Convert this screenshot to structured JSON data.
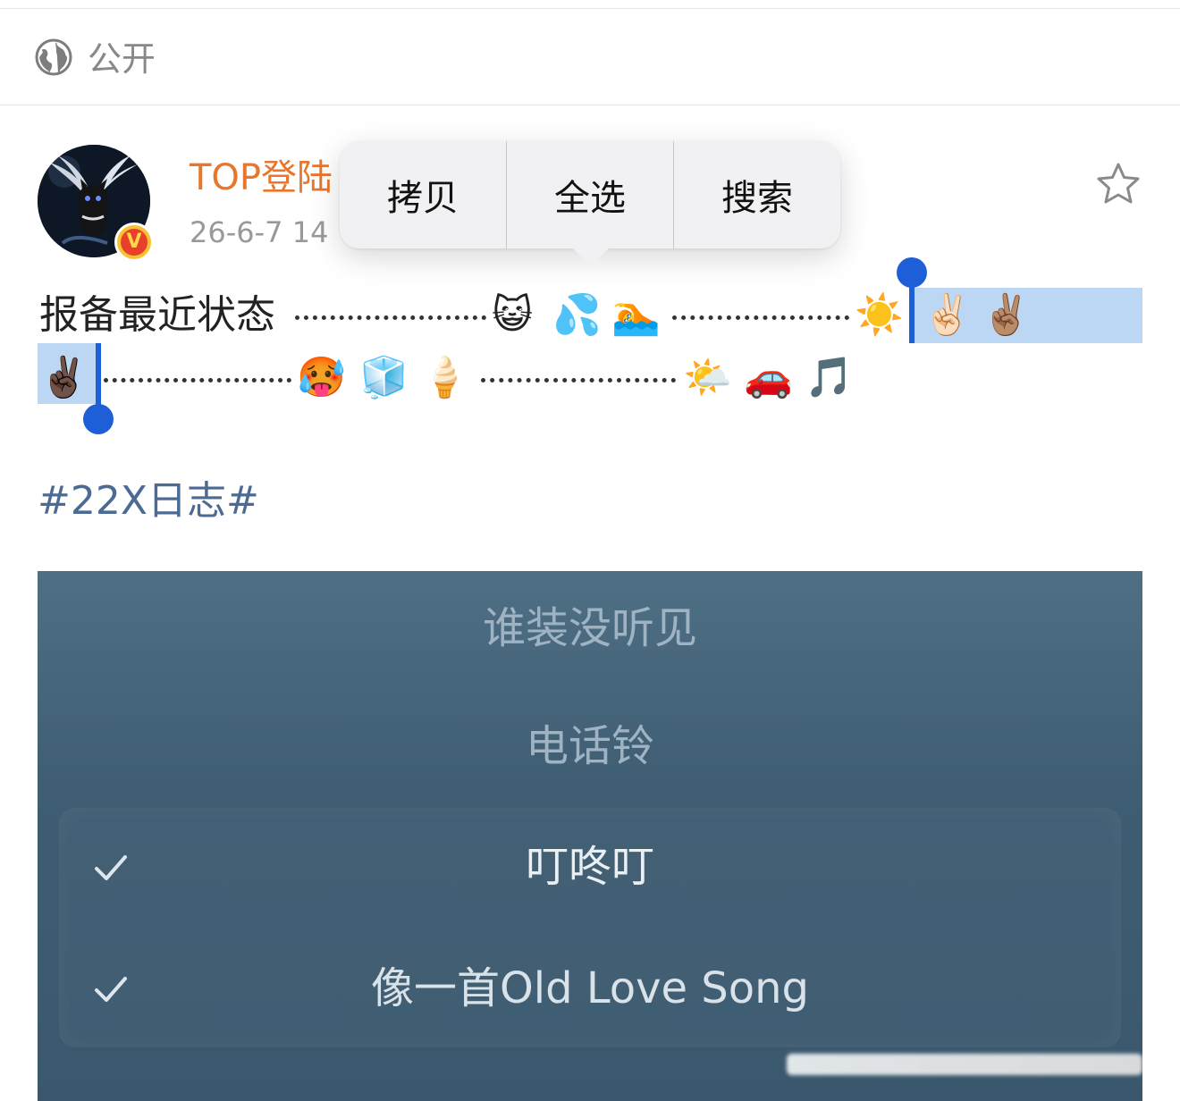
{
  "visibility": {
    "icon": "globe-icon",
    "label": "公开"
  },
  "post": {
    "avatar_icon": "winged-cat-avatar",
    "verified_icon": "verified-v-badge",
    "username": "TOP登陆",
    "timestamp": "26-6-7 14",
    "favorite_icon": "star-outline-icon",
    "text_prefix": "报备最近状态",
    "hashtag": "#22X日志#"
  },
  "context_menu": {
    "items": [
      "拷贝",
      "全选",
      "搜索"
    ]
  },
  "emoji": {
    "line1": [
      "😺",
      "💦",
      "🏊",
      "☀️",
      "✌🏻",
      "✌🏽"
    ],
    "line2": [
      "✌🏿",
      "🥵",
      "🧊",
      "🍦",
      "🌤️",
      "🚗",
      "🎵"
    ]
  },
  "music_card": {
    "songs_dim": [
      "谁装没听见",
      "电话铃"
    ],
    "songs_checked": [
      "叮咚叮",
      "像一首Old Love Song"
    ],
    "check_icon": "checkmark-icon"
  },
  "colors": {
    "username": "#e8762c",
    "hashtag": "#4b6a94",
    "selection": "#bcd7f4",
    "handle": "#1e5fd8",
    "card": "#3f5e74"
  }
}
